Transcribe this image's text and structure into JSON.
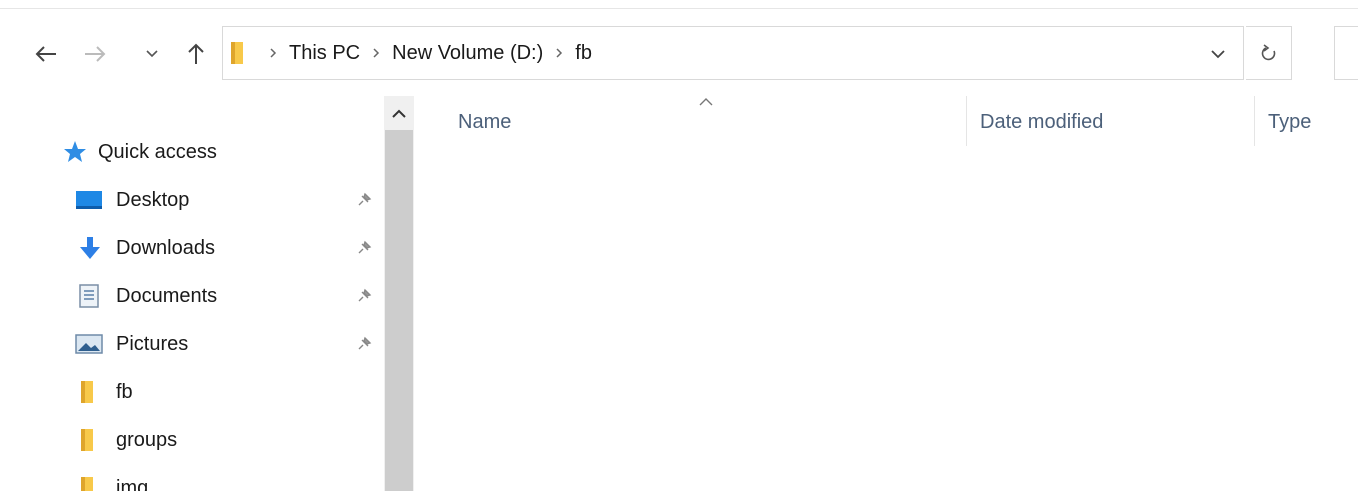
{
  "toolbar": {
    "back_icon": "arrow-left-icon",
    "forward_icon": "arrow-right-icon",
    "recent_icon": "chevron-down-icon",
    "up_icon": "arrow-up-icon",
    "refresh_icon": "refresh-icon"
  },
  "address": {
    "breadcrumbs": [
      "This PC",
      "New Volume (D:)",
      "fb"
    ]
  },
  "sidebar": {
    "items": [
      {
        "label": "Quick access",
        "icon": "star-icon",
        "pinned": false
      },
      {
        "label": "Desktop",
        "icon": "desktop-icon",
        "pinned": true
      },
      {
        "label": "Downloads",
        "icon": "download-icon",
        "pinned": true
      },
      {
        "label": "Documents",
        "icon": "document-icon",
        "pinned": true
      },
      {
        "label": "Pictures",
        "icon": "pictures-icon",
        "pinned": true
      },
      {
        "label": "fb",
        "icon": "folder-icon",
        "pinned": false
      },
      {
        "label": "groups",
        "icon": "folder-icon",
        "pinned": false
      },
      {
        "label": "img",
        "icon": "folder-icon",
        "pinned": false
      }
    ]
  },
  "columns": {
    "name": "Name",
    "date_modified": "Date modified",
    "type": "Type"
  },
  "colors": {
    "folder": "#f8c94a",
    "folder_dark": "#dfa52b",
    "quick_access_star": "#2f8de4",
    "desktop_blue": "#1e88e5",
    "downloads_blue": "#2d7fe6",
    "column_header_text": "#4c607a"
  }
}
